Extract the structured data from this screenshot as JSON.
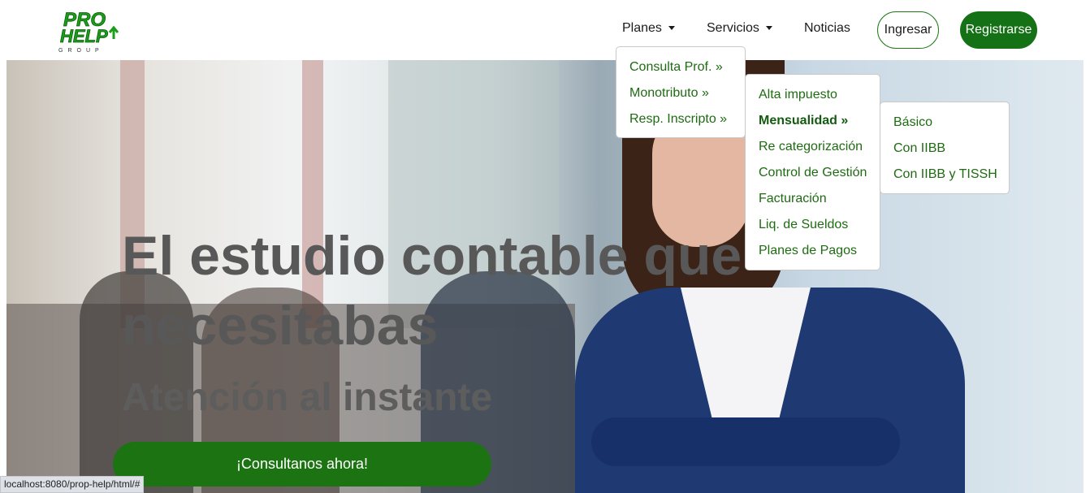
{
  "brand": {
    "logo_top": "PRO",
    "logo_bottom": "HELP",
    "logo_sub": "GROUP",
    "color": "#1a9e1a"
  },
  "nav": {
    "planes": "Planes",
    "servicios": "Servicios",
    "noticias": "Noticias",
    "ingresar": "Ingresar",
    "registrarse": "Registrarse"
  },
  "hero": {
    "title": "El estudio contable que necesitabas",
    "subtitle": "Atención al instante",
    "cta": "¡Consultanos ahora!"
  },
  "menus": {
    "planes": [
      {
        "label": "Consulta Prof. »"
      },
      {
        "label": "Monotributo »"
      },
      {
        "label": "Resp. Inscripto »"
      }
    ],
    "monotributo": [
      {
        "label": "Alta impuesto"
      },
      {
        "label": "Mensualidad »"
      },
      {
        "label": "Re categorización"
      },
      {
        "label": "Control de Gestión"
      },
      {
        "label": "Facturación"
      },
      {
        "label": "Liq. de Sueldos"
      },
      {
        "label": "Planes de Pagos"
      }
    ],
    "mensualidad": [
      {
        "label": "Básico"
      },
      {
        "label": "Con IIBB"
      },
      {
        "label": "Con IIBB y TISSH"
      }
    ]
  },
  "status_bar": {
    "url": "localhost:8080/prop-help/html/#"
  },
  "colors": {
    "primary_green": "#157115",
    "link_green": "#1e6b12",
    "hero_text": "#595858"
  }
}
